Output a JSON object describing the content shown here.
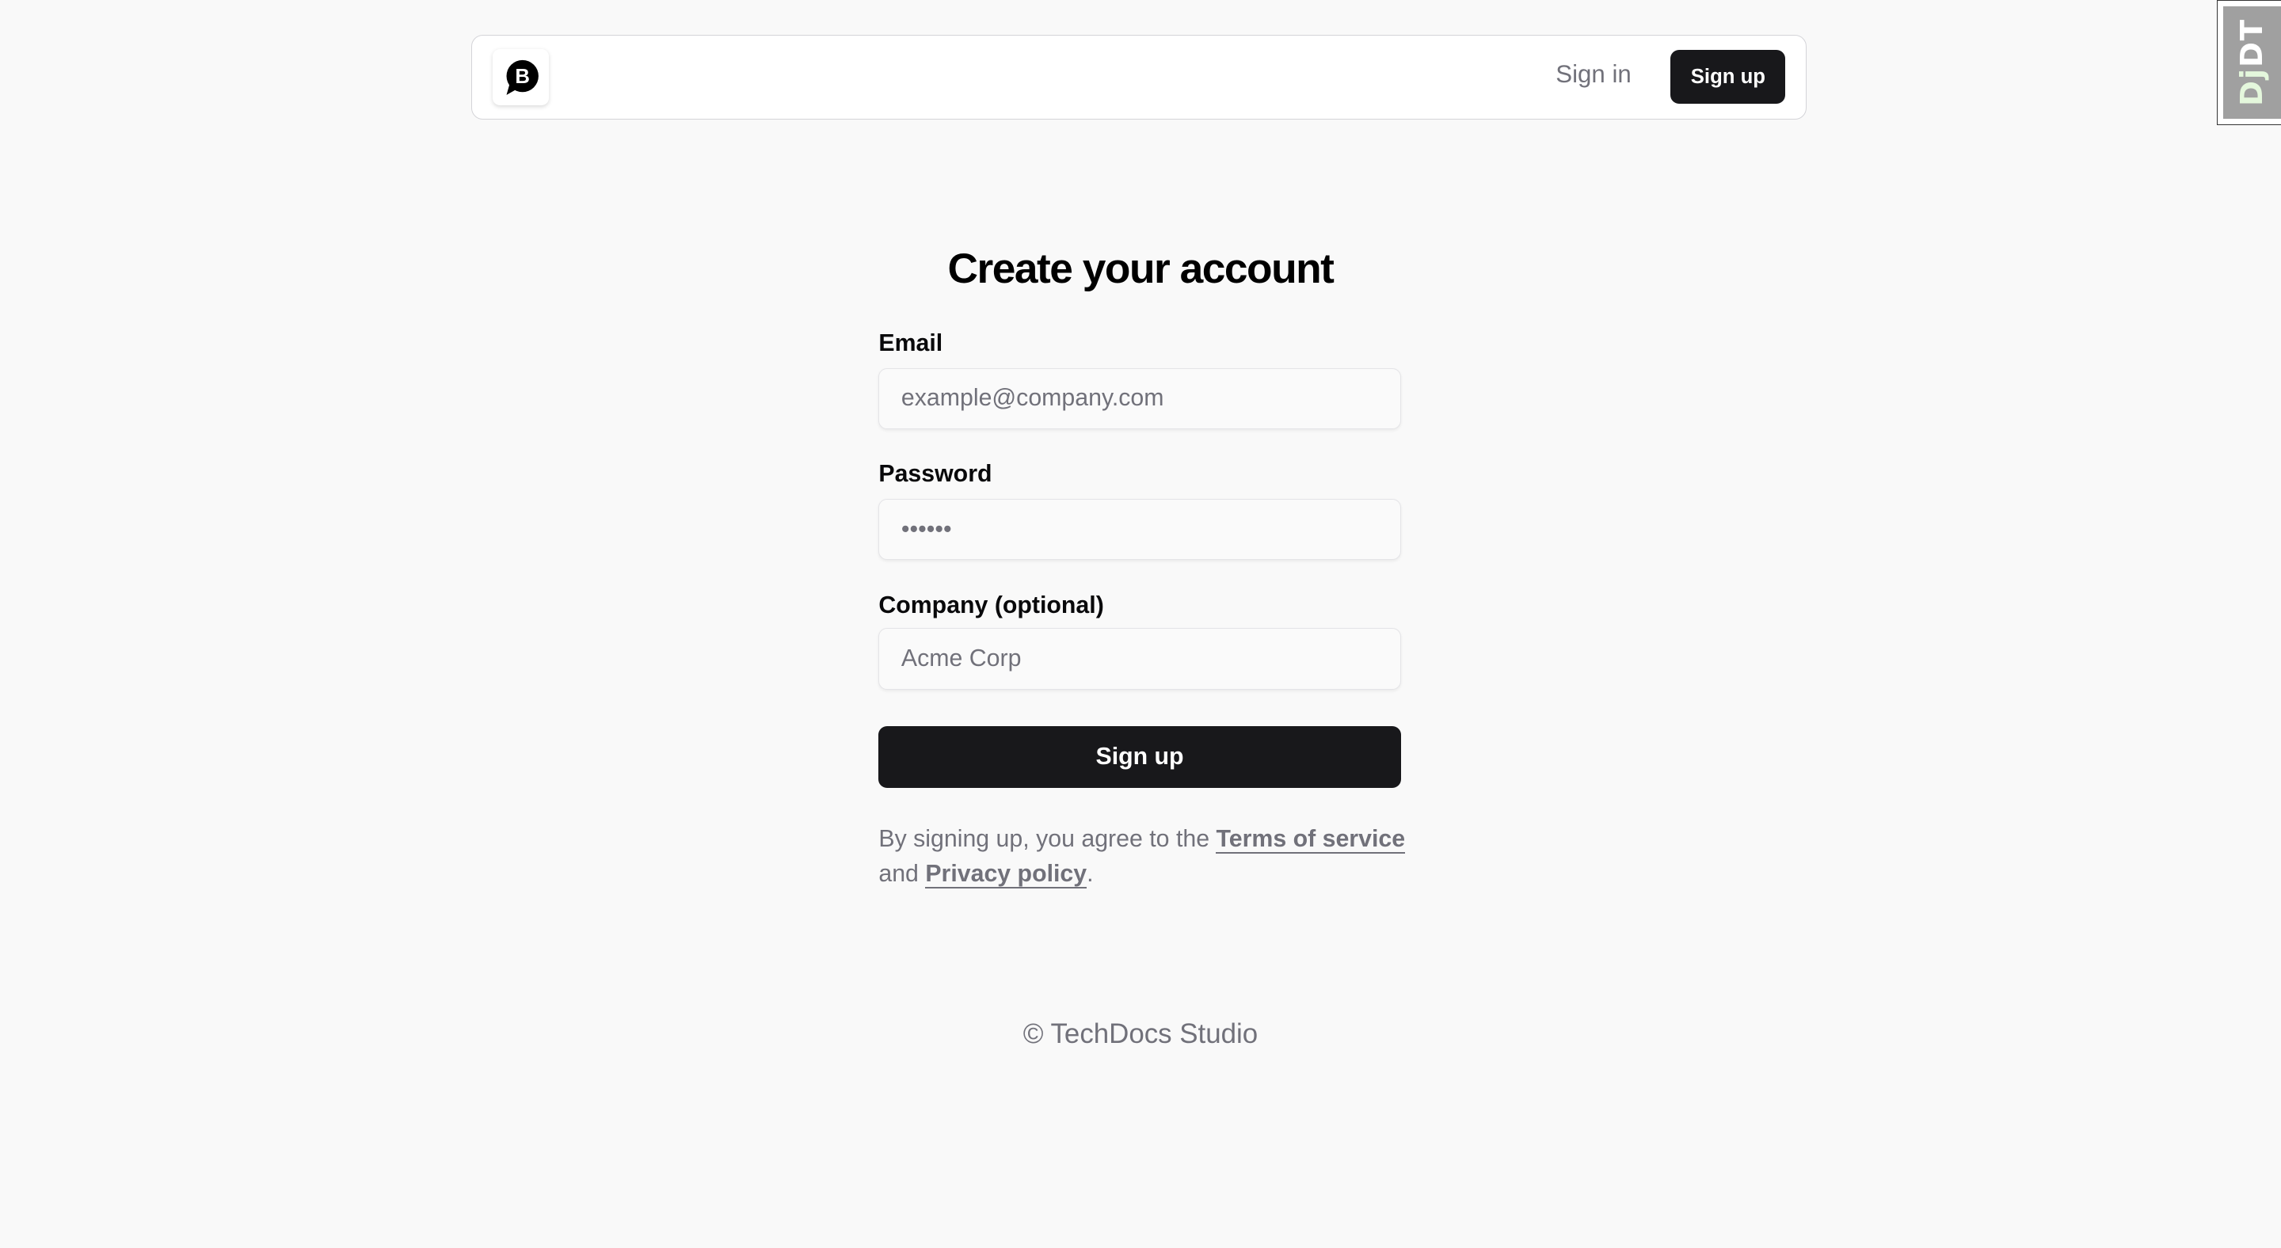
{
  "navbar": {
    "logo_icon": "brand-b-chat-bubble-icon",
    "sign_in_label": "Sign in",
    "sign_up_label": "Sign up"
  },
  "page": {
    "title": "Create your account"
  },
  "form": {
    "email": {
      "label": "Email",
      "placeholder": "example@company.com",
      "value": ""
    },
    "password": {
      "label": "Password",
      "placeholder": "••••••",
      "value": ""
    },
    "company": {
      "label": "Company (optional)",
      "placeholder": "Acme Corp",
      "value": ""
    },
    "submit_label": "Sign up",
    "terms": {
      "prefix": "By signing up, you agree to the ",
      "terms_link": "Terms of service",
      "middle": " and ",
      "privacy_link": "Privacy policy",
      "suffix": "."
    }
  },
  "footer": {
    "copyright": "© TechDocs Studio"
  },
  "debug_toolbar": {
    "label_dj": "Dj",
    "label_dt": "DT"
  },
  "colors": {
    "background": "#f9f9f9",
    "primary": "#18181b",
    "muted_text": "#71717a",
    "border": "#e4e4e7"
  }
}
